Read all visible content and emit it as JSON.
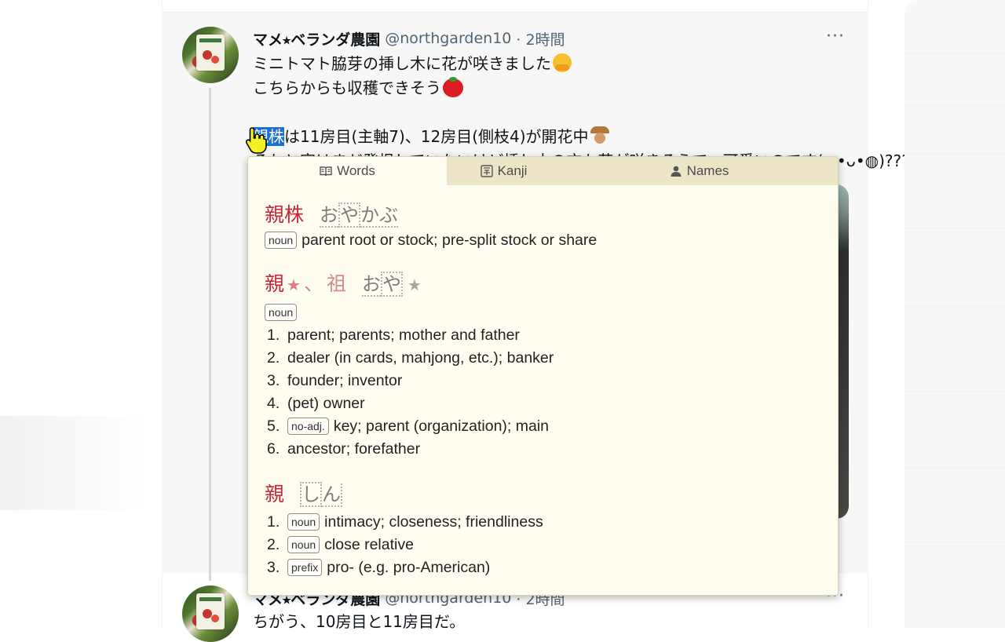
{
  "tweet1": {
    "display_name": "マメ⭑ベランダ農園",
    "handle": "@northgarden10",
    "time": "· 2時間",
    "more": "···",
    "line1": "ミニトマト脇芽の挿し木に花が咲きました",
    "line2": "こちらからも収穫できそう",
    "line3_highlight": "親株",
    "line3_rest": "は11房目(主軸7)、12房目(側枝4)が開花中",
    "line4_partial": "それと実はまだ発根していないけど挿し木の方も花が咲きそうで、可愛いのです(◍•ᴗ•◍)???"
  },
  "tweet2": {
    "display_name": "マメ⭑ベランダ農園",
    "handle": "@northgarden10",
    "time": "· 2時間",
    "more": "···",
    "text": "ちがう、10房目と11房目だ。"
  },
  "popup": {
    "tabs": [
      {
        "label": "Words",
        "icon": "book-icon",
        "active": true
      },
      {
        "label": "Kanji",
        "icon": "kanji-icon",
        "active": false
      },
      {
        "label": "Names",
        "icon": "person-icon",
        "active": false
      }
    ],
    "entry1": {
      "kanji": "親株",
      "reading": [
        "お",
        "や",
        "かぶ"
      ],
      "pos": "noun",
      "gloss": "parent root or stock; pre-split stock or share"
    },
    "entry2": {
      "kanji": "親",
      "sep": "、",
      "alt_kanji": "祖",
      "reading": [
        "お",
        "や"
      ],
      "pos": "noun",
      "senses": [
        {
          "n": "1.",
          "text": "parent; parents; mother and father"
        },
        {
          "n": "2.",
          "text": "dealer (in cards, mahjong, etc.); banker"
        },
        {
          "n": "3.",
          "text": "founder; inventor"
        },
        {
          "n": "4.",
          "text": "(pet) owner"
        },
        {
          "n": "5.",
          "pos": "no-adj.",
          "text": "key; parent (organization); main"
        },
        {
          "n": "6.",
          "text": "ancestor; forefather"
        }
      ]
    },
    "entry3": {
      "kanji": "親",
      "reading": [
        "し",
        "ん"
      ],
      "senses": [
        {
          "n": "1.",
          "pos": "noun",
          "text": "intimacy; closeness; friendliness"
        },
        {
          "n": "2.",
          "pos": "noun",
          "text": "close relative"
        },
        {
          "n": "3.",
          "pos": "prefix",
          "text": "pro- (e.g. pro-American)"
        }
      ]
    }
  }
}
